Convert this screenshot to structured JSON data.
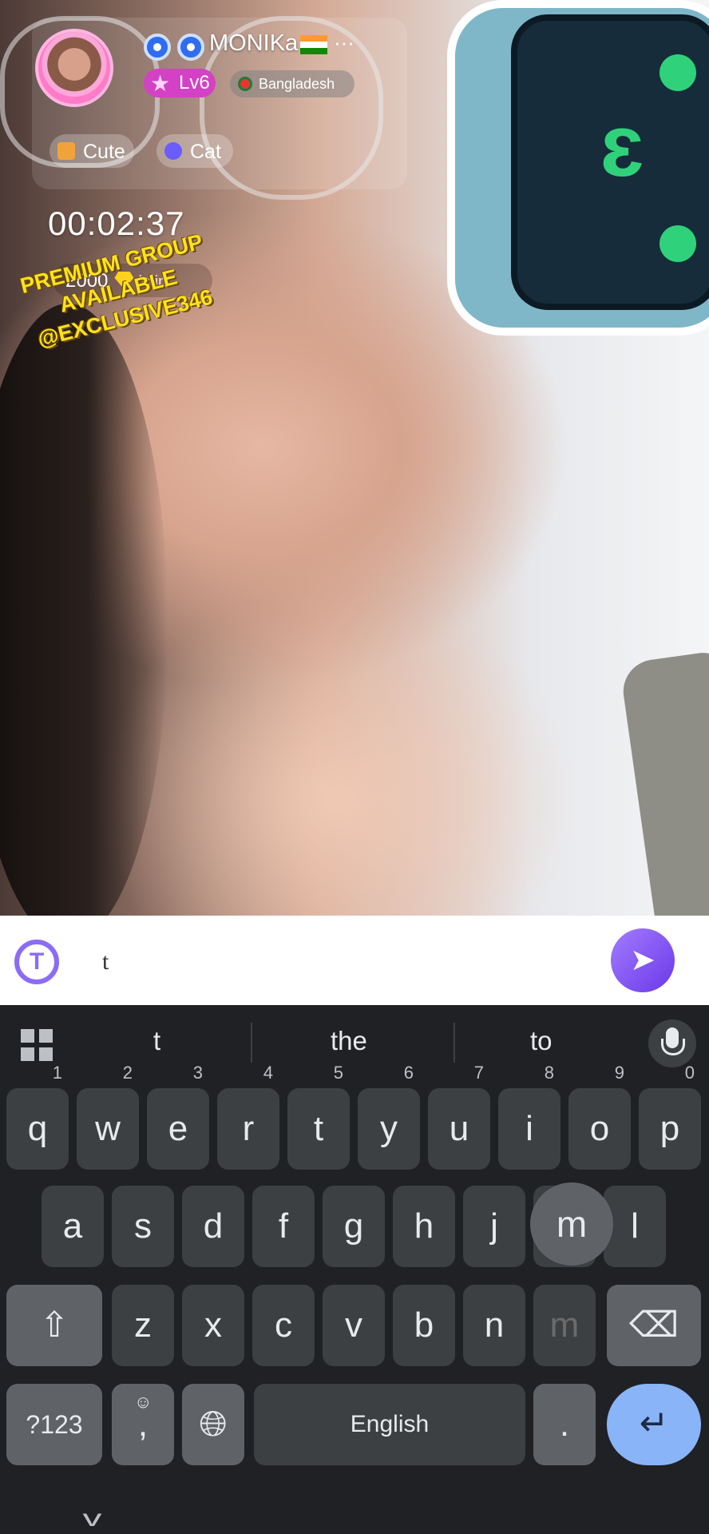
{
  "stream": {
    "username": "MONIKa",
    "more": "···",
    "level": "Lv6",
    "country": "Bangladesh",
    "tags": [
      {
        "label": "Cute"
      },
      {
        "label": "Cat"
      }
    ],
    "timer": "00:02:37",
    "rate_amount": "2000",
    "rate_unit": "/min",
    "promo_lines": [
      "PREMIUM GROUP",
      "AVAILABLE",
      "@EXCLUSIVE346"
    ]
  },
  "chat": {
    "input_value": "t",
    "translate_icon": "translate-icon",
    "send_icon": "send-icon"
  },
  "keyboard": {
    "suggestions": [
      "t",
      "the",
      "to"
    ],
    "row1": [
      {
        "key": "q",
        "hint": "1"
      },
      {
        "key": "w",
        "hint": "2"
      },
      {
        "key": "e",
        "hint": "3"
      },
      {
        "key": "r",
        "hint": "4"
      },
      {
        "key": "t",
        "hint": "5"
      },
      {
        "key": "y",
        "hint": "6"
      },
      {
        "key": "u",
        "hint": "7"
      },
      {
        "key": "i",
        "hint": "8"
      },
      {
        "key": "o",
        "hint": "9"
      },
      {
        "key": "p",
        "hint": "0"
      }
    ],
    "row2": [
      "a",
      "s",
      "d",
      "f",
      "g",
      "h",
      "j",
      "k",
      "l"
    ],
    "row3": [
      "z",
      "x",
      "c",
      "v",
      "b",
      "n",
      "m"
    ],
    "pressed_key": "m",
    "symbols_label": "?123",
    "comma_label": ",",
    "space_label": "English",
    "period_label": "."
  }
}
